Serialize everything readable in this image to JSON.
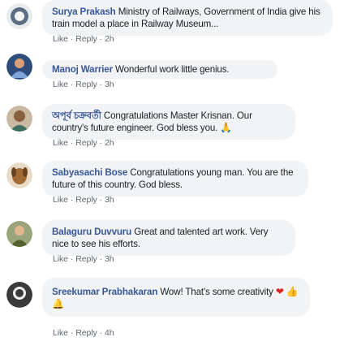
{
  "comments": [
    {
      "author": "Surya Prakash",
      "text": "Ministry of Railways, Government of India give his train model a place in Railway Museum...",
      "like_label": "Like",
      "reply_label": "Reply",
      "time": "2h",
      "avatar_icon": "orange-circle-avatar",
      "avatar_color": "#6b7c94"
    },
    {
      "author": "Manoj Warrier",
      "text": "Wonderful work little genius.",
      "like_label": "Like",
      "reply_label": "Reply",
      "time": "3h",
      "avatar_icon": "person-photo-avatar",
      "avatar_color": "#3a5e8a"
    },
    {
      "author": "অপূর্ব চক্রবর্তী",
      "text": "Congratulations Master Krisnan. Our country's future engineer. God bless you.",
      "emoji": "🙏",
      "like_label": "Like",
      "reply_label": "Reply",
      "time": "2h",
      "avatar_icon": "person-photo-avatar",
      "avatar_color": "#b08a6a"
    },
    {
      "author": "Sabyasachi Bose",
      "text": "Congratulations young man. You are the future of this country. God bless.",
      "like_label": "Like",
      "reply_label": "Reply",
      "time": "3h",
      "avatar_icon": "dog-photo-avatar",
      "avatar_color": "#9c6b3c"
    },
    {
      "author": "Balaguru Duvvuru",
      "text": "Great and talented art work. Very nice to see his efforts.",
      "like_label": "Like",
      "reply_label": "Reply",
      "time": "3h",
      "avatar_icon": "person-photo-avatar",
      "avatar_color": "#7a8a55"
    },
    {
      "author": "Sreekumar Prabhakaran",
      "text": "Wow! That's some creativity",
      "emoji_a": "❤",
      "emoji_b": "👍",
      "emoji_c": "🔔",
      "like_label": "Like",
      "reply_label": "Reply",
      "time": "4h",
      "avatar_icon": "person-photo-avatar",
      "avatar_color": "#4a4a4a"
    }
  ],
  "colors": {
    "bubble_bg": "#f2f3f5",
    "author": "#385898",
    "meta": "#606770"
  }
}
